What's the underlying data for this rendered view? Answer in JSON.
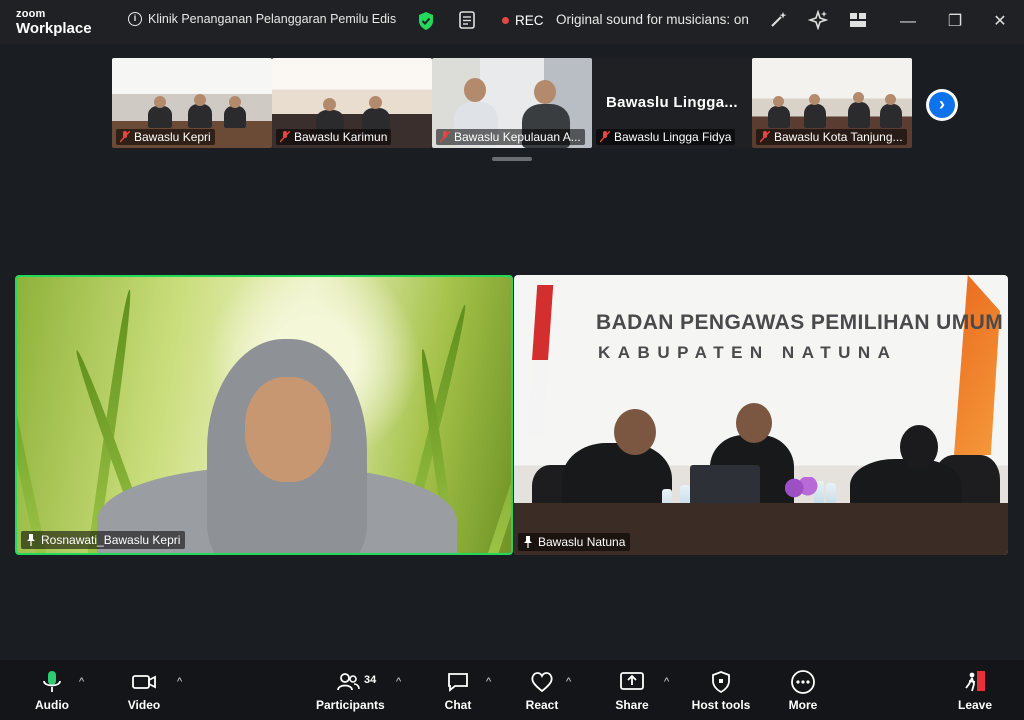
{
  "app": {
    "brand_top": "zoom",
    "brand_bottom": "Workplace"
  },
  "titlebar": {
    "meeting_title": "Klinik Penanganan Pelanggaran Pemilu Edis",
    "rec_label": "REC",
    "sound_label": "Original sound for musicians: on"
  },
  "filmstrip": {
    "tiles": [
      {
        "name": "Bawaslu Kepri"
      },
      {
        "name": "Bawaslu Karimun"
      },
      {
        "name": "Bawaslu Kepulauan A..."
      },
      {
        "name": "Bawaslu Lingga Fidya",
        "display_text": "Bawaslu  Lingga..."
      },
      {
        "name": "Bawaslu Kota Tanjung..."
      }
    ]
  },
  "main": {
    "left_name": "Rosnawati_Bawaslu Kepri",
    "right_name": "Bawaslu Natuna",
    "banner_line1": "BADAN PENGAWAS PEMILIHAN UMUM",
    "banner_line2": "KABUPATEN NATUNA"
  },
  "toolbar": {
    "audio": "Audio",
    "video": "Video",
    "participants": "Participants",
    "participants_count": "34",
    "chat": "Chat",
    "react": "React",
    "share": "Share",
    "host_tools": "Host tools",
    "more": "More",
    "leave": "Leave"
  },
  "colors": {
    "active_speaker": "#23d959",
    "rec": "#e84545",
    "leave": "#e8323a",
    "accent": "#0e72ed"
  }
}
